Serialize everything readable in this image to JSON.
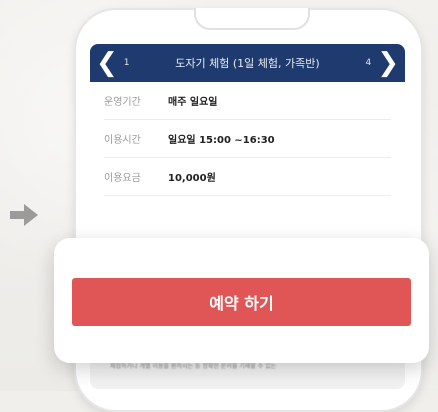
{
  "header": {
    "title": "도자기 체험 (1일 체험, 가족반)",
    "prev_count": "1",
    "next_count": "4"
  },
  "rows": [
    {
      "label": "운영기간",
      "value": "매주 일요일"
    },
    {
      "label": "이용시간",
      "value": "일요일 15:00 ~16:30"
    },
    {
      "label": "이용요금",
      "value": "10,000원"
    }
  ],
  "footnote": "체험하거나 개별 이용을 원하시는 등 정확한 문의를 기재할 수 있는",
  "reserve": {
    "label": "예약 하기"
  },
  "colors": {
    "header": "#1e3a6e",
    "button": "#e05555"
  },
  "icons": {
    "prev": "chevron-left-icon",
    "next": "chevron-right-icon",
    "pointer": "arrow-right-icon"
  }
}
